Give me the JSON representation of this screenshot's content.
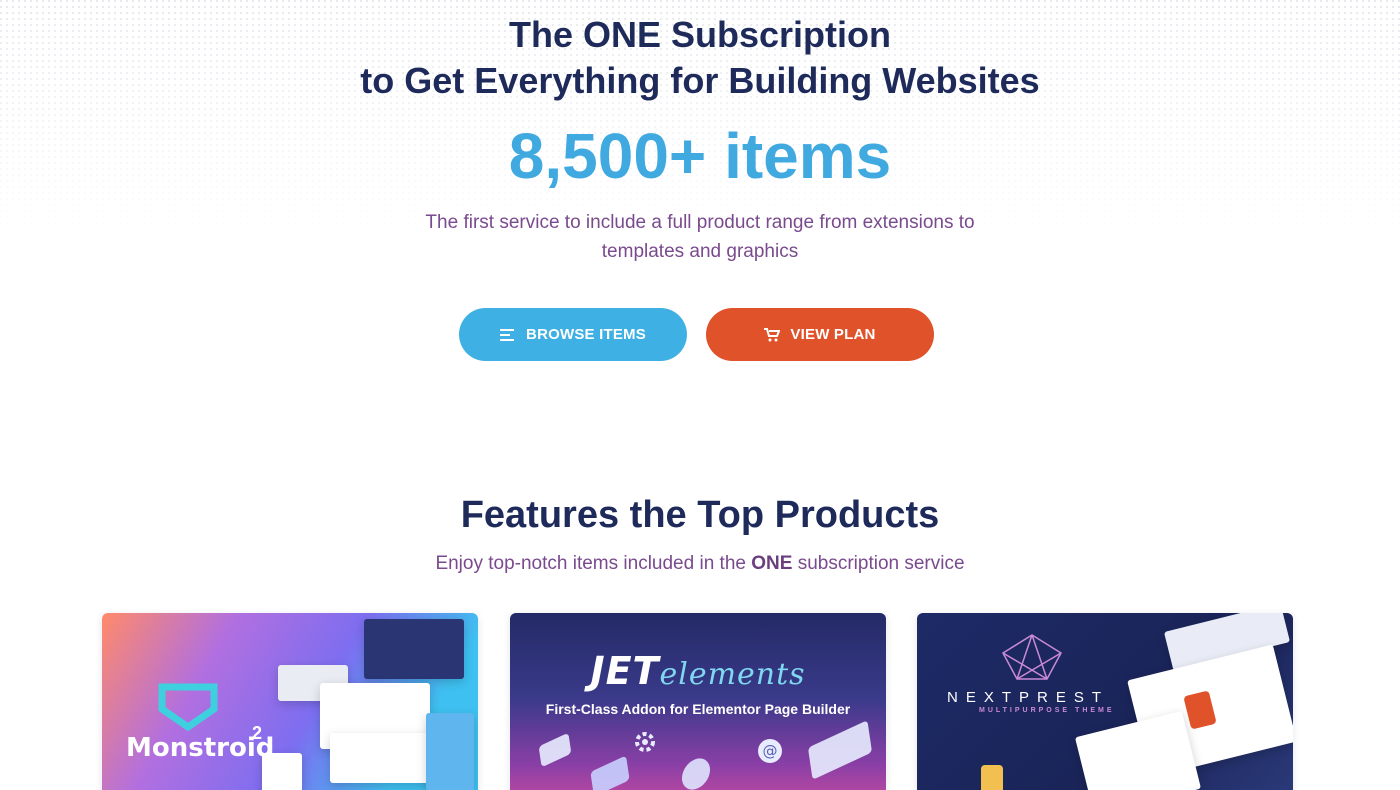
{
  "hero": {
    "title_line1": "The ONE Subscription",
    "title_line2": "to Get Everything for Building Websites",
    "count": "8,500+ items",
    "description": "The first service to include a full product range from extensions to templates and graphics",
    "browse_button": "BROWSE ITEMS",
    "plan_button": "VIEW PLAN"
  },
  "features": {
    "title": "Features the Top Products",
    "subtitle_pre": "Enjoy top-notch items included in the ",
    "subtitle_bold": "ONE",
    "subtitle_post": " subscription service"
  },
  "cards": [
    {
      "name": "Monstroid",
      "sup": "2"
    },
    {
      "logo_main": "JET",
      "logo_script": "elements",
      "tagline": "First-Class Addon for Elementor Page Builder"
    },
    {
      "name": "NEXTPREST",
      "tagline": "MULTIPURPOSE THEME"
    }
  ],
  "colors": {
    "heading": "#1e2a5a",
    "accent_blue": "#3fa9e0",
    "accent_orange": "#e0522a",
    "body_text": "#7a4a8e"
  },
  "icons": {
    "browse": "list-icon",
    "plan": "cart-icon"
  }
}
